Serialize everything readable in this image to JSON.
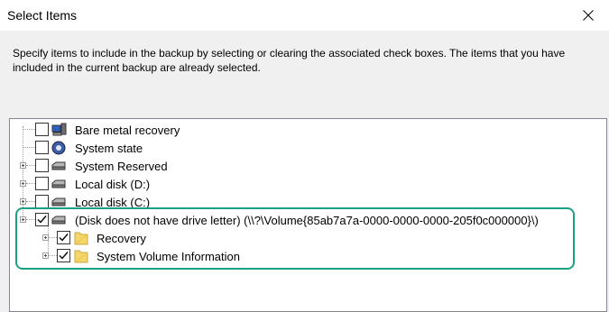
{
  "window": {
    "title": "Select Items",
    "close_icon": "close-icon"
  },
  "description": "Specify items to include in the backup by selecting or clearing the associated check boxes. The items that you have included in the current backup are already selected.",
  "tree": {
    "items": [
      {
        "label": "Bare metal recovery",
        "checked": false,
        "icon": "computer-icon"
      },
      {
        "label": "System state",
        "checked": false,
        "icon": "system-state-icon"
      },
      {
        "label": "System Reserved",
        "checked": false,
        "icon": "drive-icon"
      },
      {
        "label": "Local disk (D:)",
        "checked": false,
        "icon": "drive-icon"
      },
      {
        "label": "Local disk (C:)",
        "checked": false,
        "icon": "drive-icon"
      },
      {
        "label": "(Disk does not have drive letter) (\\\\?\\Volume{85ab7a7a-0000-0000-0000-205f0c000000}\\)",
        "checked": true,
        "icon": "drive-icon"
      },
      {
        "label": "Recovery",
        "checked": true,
        "icon": "folder-icon"
      },
      {
        "label": "System Volume Information",
        "checked": true,
        "icon": "folder-icon"
      }
    ]
  },
  "colors": {
    "highlight": "#1aa085",
    "folder": "#f5d66c"
  }
}
